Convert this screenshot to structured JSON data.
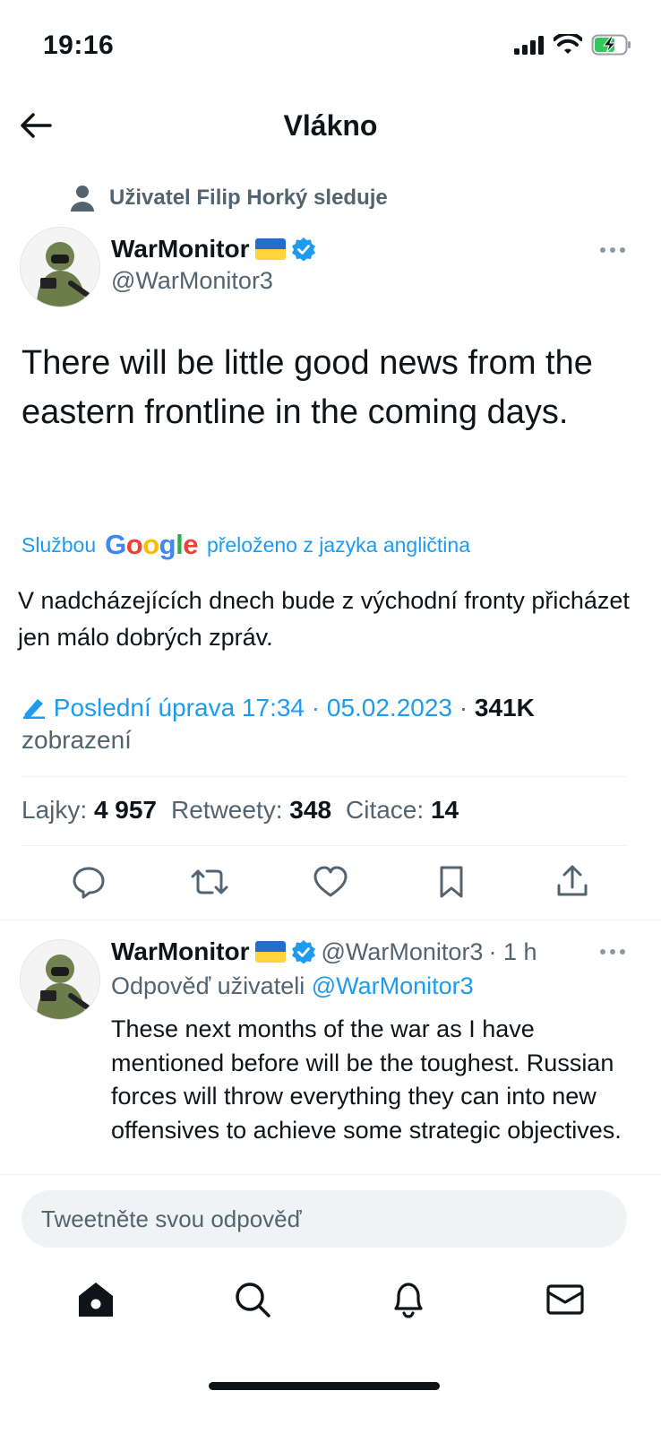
{
  "status_bar": {
    "time": "19:16"
  },
  "header": {
    "title": "Vlákno"
  },
  "social_context": {
    "text": "Uživatel Filip Horký sleduje"
  },
  "tweet": {
    "author_name": "WarMonitor",
    "author_handle": "@WarMonitor3",
    "text": "There will be little good news from the eastern frontline in the coming days.",
    "translation": {
      "prefix": "Službou",
      "brand": "Google",
      "suffix": "přeloženo z jazyka angličtina",
      "text": "V nadcházejících dnech bude z východní fronty přicházet jen málo dobrých zpráv."
    },
    "edit_label": "Poslední úprava 17:34 · 05.02.2023",
    "views_sep": " · ",
    "views_count": "341K",
    "views_label": "zobrazení",
    "stats": {
      "likes_label": "Lajky:",
      "likes": "4 957",
      "retweets_label": "Retweety:",
      "retweets": "348",
      "quotes_label": "Citace:",
      "quotes": "14"
    }
  },
  "reply": {
    "author_name": "WarMonitor",
    "author_handle": "@WarMonitor3",
    "time": "· 1 h",
    "replying_label": "Odpověď uživateli",
    "replying_to": "@WarMonitor3",
    "text": "These next months of the war as I have mentioned before will be the toughest. Russian forces will throw everything they can into new offensives to achieve some strategic objectives."
  },
  "compose": {
    "placeholder": "Tweetněte svou odpověď"
  },
  "colors": {
    "accent": "#1d9bf0",
    "muted": "#536471",
    "text": "#0f1419"
  }
}
